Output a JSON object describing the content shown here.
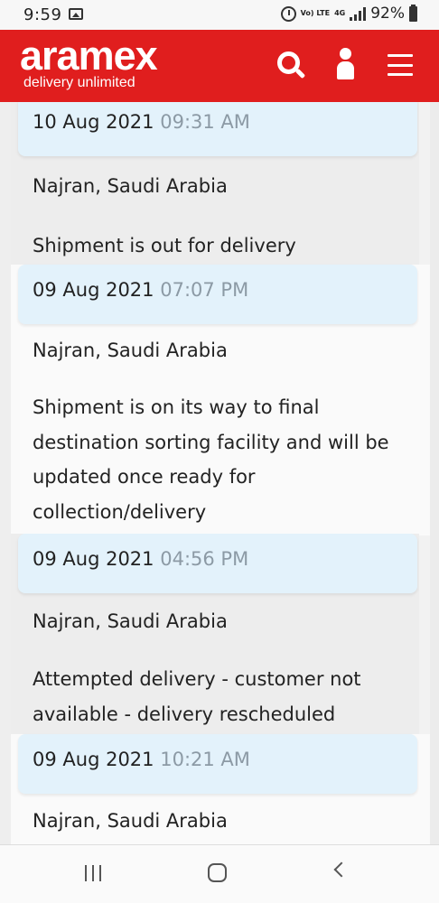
{
  "status_bar": {
    "time": "9:59",
    "volte": "Vo) LTE",
    "network": "4G",
    "battery": "92%",
    "icons": [
      "gallery-icon",
      "alarm-icon",
      "signal-icon",
      "battery-icon"
    ]
  },
  "header": {
    "logo": "aramex",
    "tagline": "delivery unlimited",
    "brand_color": "#e01e1e",
    "icons": [
      "search-icon",
      "user-icon",
      "menu-icon"
    ]
  },
  "timeline": [
    {
      "date": "10 Aug 2021",
      "time": "09:31 AM",
      "location": "Najran, Saudi Arabia",
      "description": "Shipment is out for delivery"
    },
    {
      "date": "09 Aug 2021",
      "time": "07:07 PM",
      "location": "Najran, Saudi Arabia",
      "description_lines": [
        "Shipment is on its way to final",
        "destination sorting facility and will be",
        "updated once ready for",
        "collection/delivery"
      ]
    },
    {
      "date": "09 Aug 2021",
      "time": "04:56 PM",
      "location": "Najran, Saudi Arabia",
      "description_lines": [
        "Attempted delivery - customer not",
        "available - delivery rescheduled"
      ]
    },
    {
      "date": "09 Aug 2021",
      "time": "10:21 AM",
      "location": "Najran, Saudi Arabia"
    }
  ],
  "nav_bar": {
    "icons": [
      "recents-icon",
      "home-icon",
      "back-icon"
    ]
  }
}
